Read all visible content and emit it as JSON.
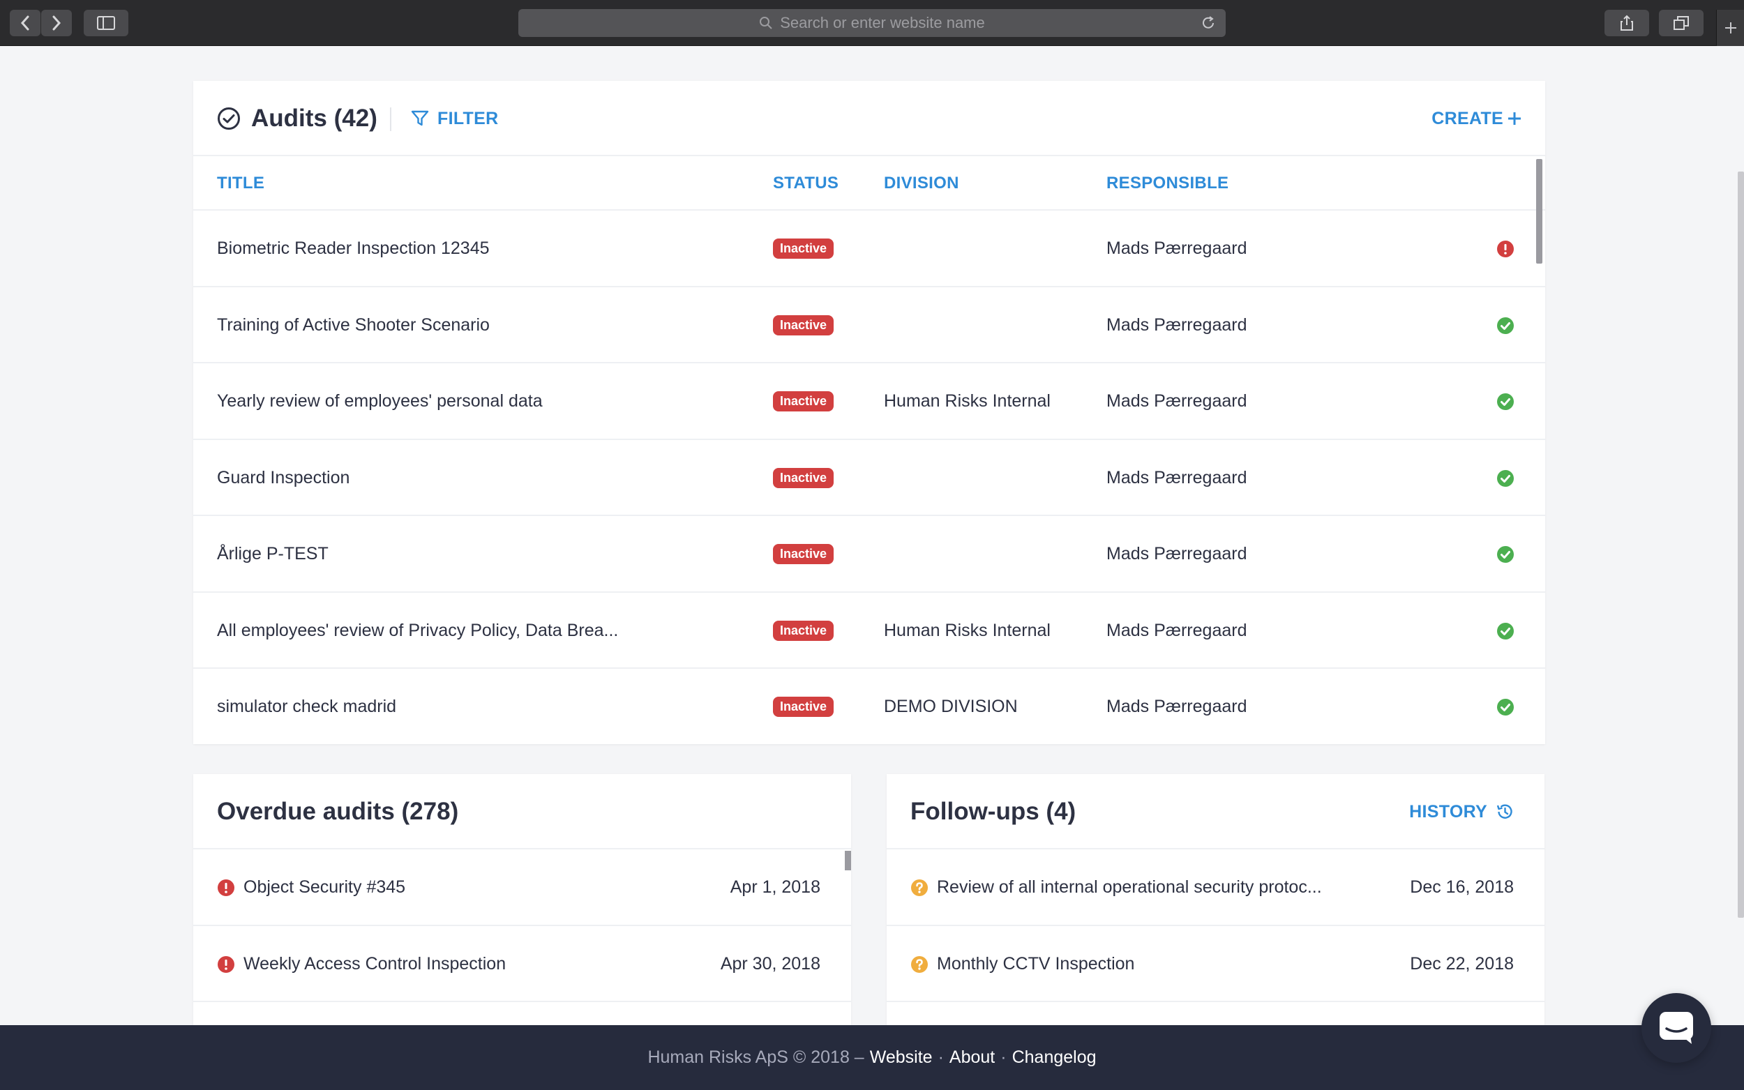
{
  "browser": {
    "url_placeholder": "Search or enter website name"
  },
  "audits": {
    "title": "Audits (42)",
    "filter_label": "FILTER",
    "create_label": "CREATE",
    "columns": {
      "title": "TITLE",
      "status": "STATUS",
      "division": "DIVISION",
      "responsible": "RESPONSIBLE"
    },
    "rows": [
      {
        "title": "Biometric Reader Inspection 12345",
        "status": "Inactive",
        "division": "",
        "responsible": "Mads Pærregaard",
        "indicator": "error"
      },
      {
        "title": "Training of Active Shooter Scenario",
        "status": "Inactive",
        "division": "",
        "responsible": "Mads Pærregaard",
        "indicator": "ok"
      },
      {
        "title": "Yearly review of employees' personal data",
        "status": "Inactive",
        "division": "Human Risks Internal",
        "responsible": "Mads Pærregaard",
        "indicator": "ok"
      },
      {
        "title": "Guard Inspection",
        "status": "Inactive",
        "division": "",
        "responsible": "Mads Pærregaard",
        "indicator": "ok"
      },
      {
        "title": "Årlige P-TEST",
        "status": "Inactive",
        "division": "",
        "responsible": "Mads Pærregaard",
        "indicator": "ok"
      },
      {
        "title": "All employees' review of Privacy Policy, Data Brea...",
        "status": "Inactive",
        "division": "Human Risks Internal",
        "responsible": "Mads Pærregaard",
        "indicator": "ok"
      },
      {
        "title": "simulator check madrid",
        "status": "Inactive",
        "division": "DEMO DIVISION",
        "responsible": "Mads Pærregaard",
        "indicator": "ok"
      }
    ]
  },
  "overdue": {
    "title": "Overdue audits (278)",
    "items": [
      {
        "title": "Object Security #345",
        "date": "Apr 1, 2018"
      },
      {
        "title": "Weekly Access Control Inspection",
        "date": "Apr 30, 2018"
      }
    ]
  },
  "followups": {
    "title": "Follow-ups (4)",
    "history_label": "HISTORY",
    "items": [
      {
        "title": "Review of all internal operational security protoc...",
        "date": "Dec 16, 2018"
      },
      {
        "title": "Monthly CCTV Inspection",
        "date": "Dec 22, 2018"
      }
    ]
  },
  "footer": {
    "copyright": "Human Risks ApS © 2018 –",
    "links": [
      "Website",
      "About",
      "Changelog"
    ],
    "separator": "·"
  },
  "colors": {
    "accent": "#2e8bd8",
    "error": "#d23f3f",
    "ok": "#4caf50",
    "warning": "#f0ad3e",
    "footer_bg": "#262b3d"
  }
}
